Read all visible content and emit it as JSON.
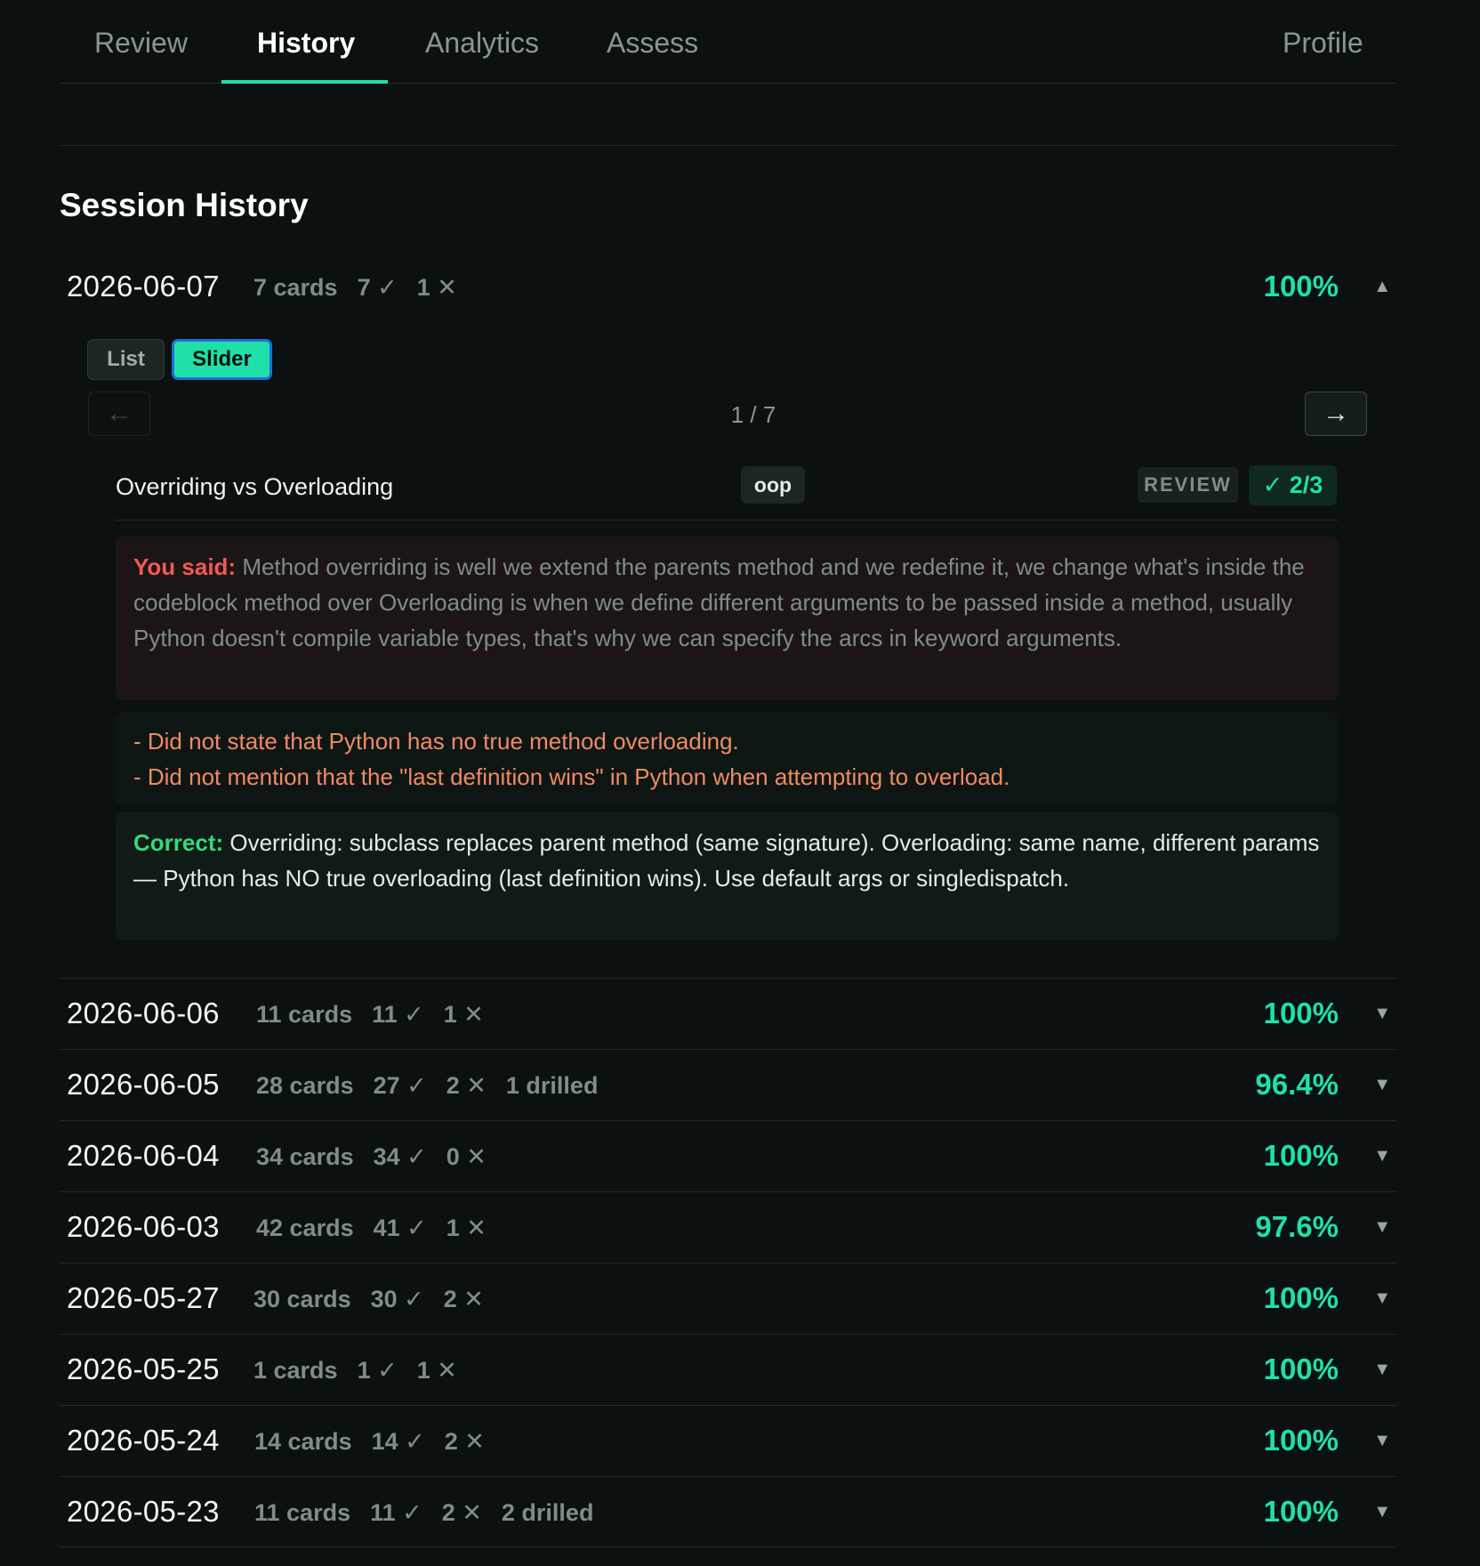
{
  "tabs": [
    {
      "label": "Review"
    },
    {
      "label": "History"
    },
    {
      "label": "Analytics"
    },
    {
      "label": "Assess"
    },
    {
      "label": "Profile"
    }
  ],
  "active_tab": "History",
  "page_title": "Session History",
  "expanded": {
    "date": "2026-06-07",
    "cards": "7 cards",
    "correct": "7 ✓",
    "wrong": "1 ✕",
    "pct": "100%",
    "chevron": "▲",
    "view_toggle": {
      "list": "List",
      "slider": "Slider",
      "selected": "Slider"
    },
    "nav": {
      "prev": "←",
      "next": "→",
      "counter": "1 / 7"
    },
    "card": {
      "title": "Overriding vs Overloading",
      "tag": "oop",
      "mode": "REVIEW",
      "score": "✓ 2/3",
      "you_said_label": "You said:",
      "you_said": "Method overriding is well we extend the parents method and we redefine it, we change what's inside the codeblock method over Overloading is when we define different arguments to be passed inside a method, usually Python doesn't compile variable types, that's why we can specify the arcs in keyword arguments.",
      "feedback": [
        "- Did not state that Python has no true method overloading.",
        "- Did not mention that the \"last definition wins\" in Python when attempting to overload."
      ],
      "correct_label": "Correct:",
      "correct": "Overriding: subclass replaces parent method (same signature). Overloading: same name, different params — Python has NO true overloading (last definition wins). Use default args or singledispatch."
    }
  },
  "sessions": [
    {
      "date": "2026-06-06",
      "cards": "11 cards",
      "correct": "11 ✓",
      "wrong": "1 ✕",
      "drilled": "",
      "pct": "100%",
      "chevron": "▼"
    },
    {
      "date": "2026-06-05",
      "cards": "28 cards",
      "correct": "27 ✓",
      "wrong": "2 ✕",
      "drilled": "1 drilled",
      "pct": "96.4%",
      "chevron": "▼"
    },
    {
      "date": "2026-06-04",
      "cards": "34 cards",
      "correct": "34 ✓",
      "wrong": "0 ✕",
      "drilled": "",
      "pct": "100%",
      "chevron": "▼"
    },
    {
      "date": "2026-06-03",
      "cards": "42 cards",
      "correct": "41 ✓",
      "wrong": "1 ✕",
      "drilled": "",
      "pct": "97.6%",
      "chevron": "▼"
    },
    {
      "date": "2026-05-27",
      "cards": "30 cards",
      "correct": "30 ✓",
      "wrong": "2 ✕",
      "drilled": "",
      "pct": "100%",
      "chevron": "▼"
    },
    {
      "date": "2026-05-25",
      "cards": "1 cards",
      "correct": "1 ✓",
      "wrong": "1 ✕",
      "drilled": "",
      "pct": "100%",
      "chevron": "▼"
    },
    {
      "date": "2026-05-24",
      "cards": "14 cards",
      "correct": "14 ✓",
      "wrong": "2 ✕",
      "drilled": "",
      "pct": "100%",
      "chevron": "▼"
    },
    {
      "date": "2026-05-23",
      "cards": "11 cards",
      "correct": "11 ✓",
      "wrong": "2 ✕",
      "drilled": "2 drilled",
      "pct": "100%",
      "chevron": "▼"
    }
  ],
  "colors": {
    "accent": "#1fe0a8",
    "background": "#0b1110",
    "error": "#ef5a56",
    "feedback": "#f08a63",
    "correct": "#36d879"
  }
}
